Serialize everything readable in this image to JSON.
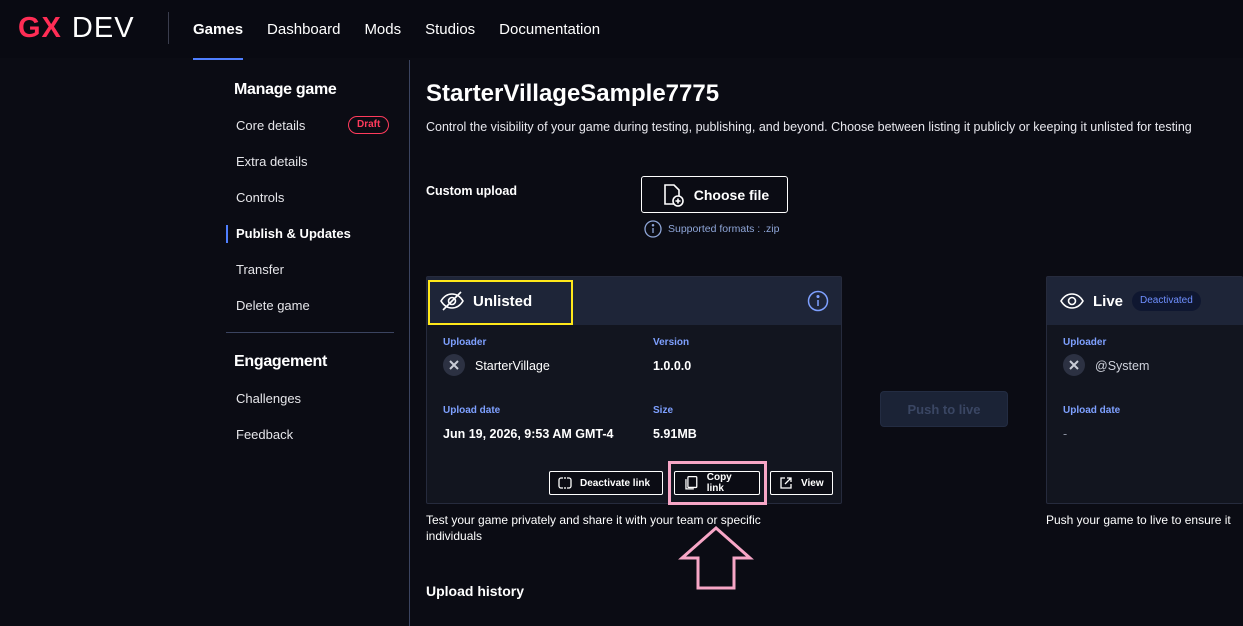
{
  "logo": {
    "part1": "GX",
    "part2": "DEV"
  },
  "nav": [
    "Games",
    "Dashboard",
    "Mods",
    "Studios",
    "Documentation"
  ],
  "sidebar": {
    "manage_heading": "Manage game",
    "manage_items": [
      {
        "label": "Core details",
        "badge": "Draft"
      },
      {
        "label": "Extra details"
      },
      {
        "label": "Controls"
      },
      {
        "label": "Publish & Updates"
      },
      {
        "label": "Transfer"
      },
      {
        "label": "Delete game"
      }
    ],
    "engagement_heading": "Engagement",
    "engagement_items": [
      "Challenges",
      "Feedback"
    ]
  },
  "main": {
    "title": "StarterVillageSample7775",
    "description": "Control the visibility of your game during testing, publishing, and beyond. Choose between listing it publicly or keeping it unlisted for testing",
    "custom_upload_label": "Custom upload",
    "choose_file_label": "Choose file",
    "supported_formats": "Supported formats : .zip",
    "upload_history": "Upload history"
  },
  "unlisted_card": {
    "title": "Unlisted",
    "uploader_label": "Uploader",
    "uploader_value": "StarterVillage",
    "version_label": "Version",
    "version_value": "1.0.0.0",
    "upload_date_label": "Upload date",
    "upload_date_value": "Jun 19, 2026, 9:53 AM GMT-4",
    "size_label": "Size",
    "size_value": "5.91MB",
    "deactivate_label": "Deactivate link",
    "copy_label": "Copy link",
    "view_label": "View",
    "caption_line1": "Test your game privately and share it with your team or specific",
    "caption_line2": "individuals"
  },
  "push_button": "Push to live",
  "live_card": {
    "title": "Live",
    "badge": "Deactivated",
    "uploader_label": "Uploader",
    "uploader_value": "@System",
    "upload_date_label": "Upload date",
    "upload_date_value": "-",
    "caption": "Push your game to live to ensure it"
  },
  "colors": {
    "accent": "#4f7fff",
    "brand_red": "#ff2d55",
    "highlight_yellow": "#ffe81a",
    "highlight_pink": "#f7a6c6"
  }
}
